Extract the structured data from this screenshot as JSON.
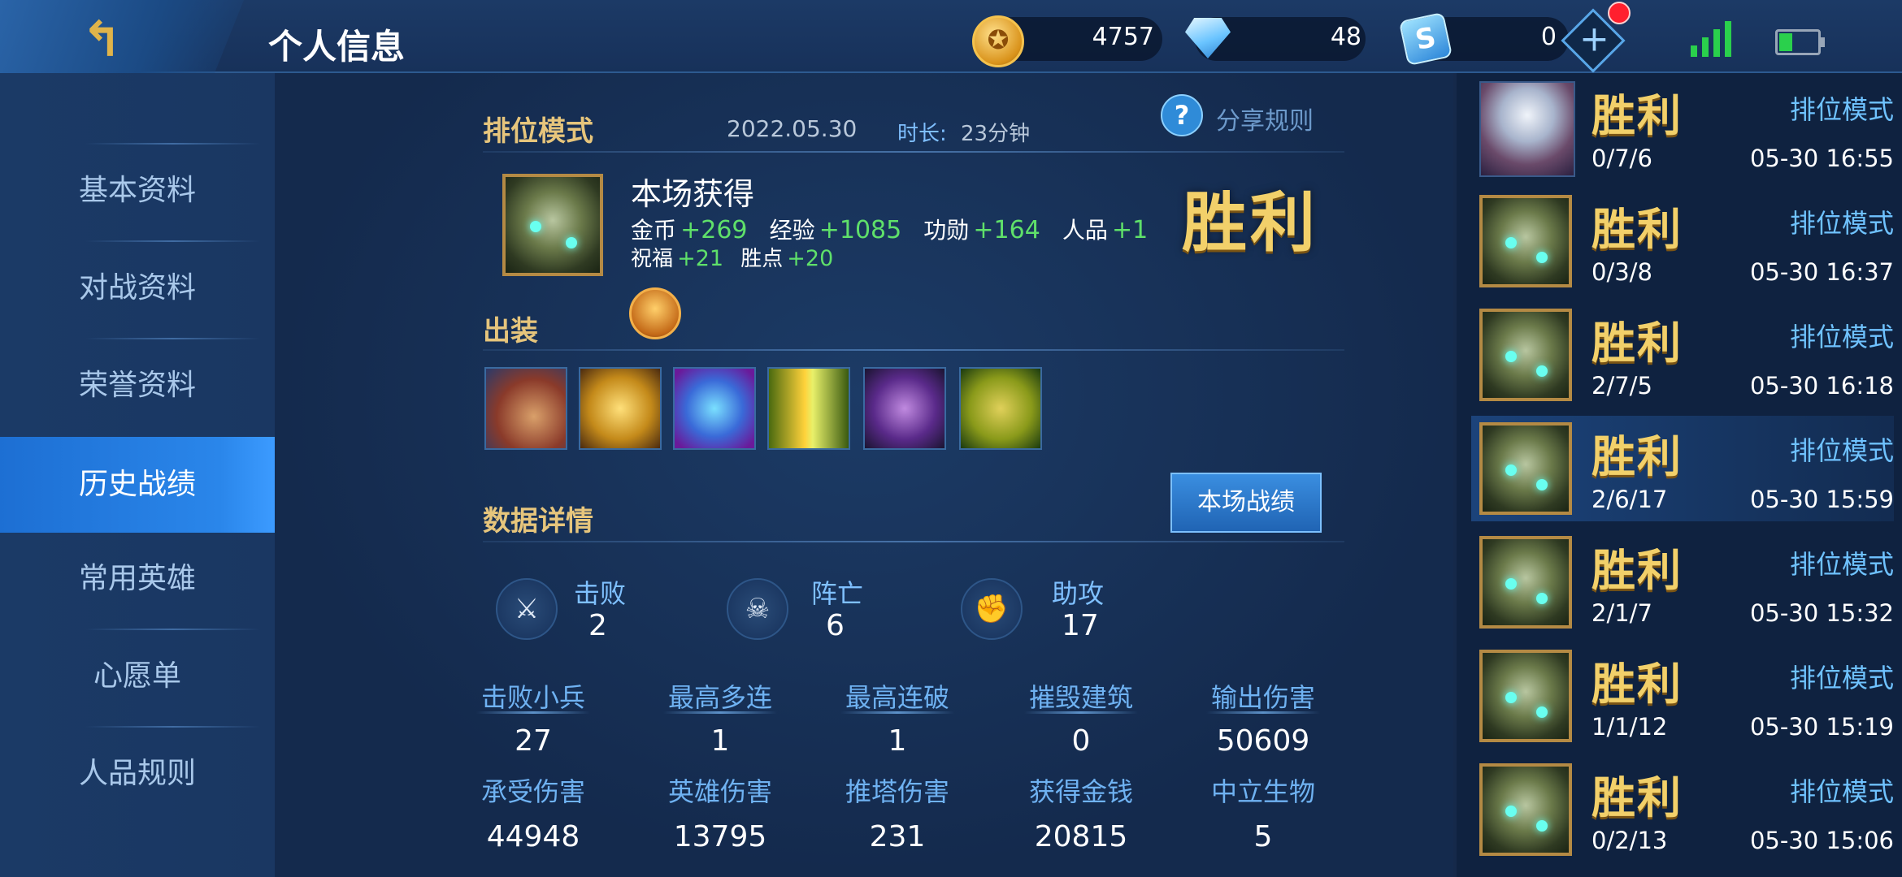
{
  "header": {
    "title": "个人信息",
    "gold": "4757",
    "diamonds": "48",
    "vouchers": "0",
    "plus_glyph": "+",
    "back_glyph": "↰"
  },
  "sidebar": {
    "items": [
      {
        "label": "基本资料"
      },
      {
        "label": "对战资料"
      },
      {
        "label": "荣誉资料"
      },
      {
        "label": "历史战绩",
        "active": true
      },
      {
        "label": "常用英雄"
      },
      {
        "label": "心愿单"
      },
      {
        "label": "人品规则"
      }
    ]
  },
  "match": {
    "mode": "排位模式",
    "date": "2022.05.30",
    "duration_label": "时长:",
    "duration": "23分钟",
    "share_label": "分享规则",
    "rewards_title": "本场获得",
    "rewards": {
      "gold_label": "金币",
      "gold": "+269",
      "exp_label": "经验",
      "exp": "+1085",
      "merit_label": "功勋",
      "merit": "+164",
      "rp_label": "人品",
      "rp": "+1",
      "bless_label": "祝福",
      "bless": "+21",
      "point_label": "胜点",
      "point": "+20"
    },
    "result": "胜利",
    "equipment_label": "出装",
    "details_label": "数据详情",
    "details_button": "本场战绩",
    "kda": {
      "kills_label": "击败",
      "kills": "2",
      "deaths_label": "阵亡",
      "deaths": "6",
      "assists_label": "助攻",
      "assists": "17"
    },
    "stats": [
      {
        "label": "击败小兵",
        "value": "27"
      },
      {
        "label": "最高多连",
        "value": "1"
      },
      {
        "label": "最高连破",
        "value": "1"
      },
      {
        "label": "摧毁建筑",
        "value": "0"
      },
      {
        "label": "输出伤害",
        "value": "50609"
      },
      {
        "label": "承受伤害",
        "value": "44948"
      },
      {
        "label": "英雄伤害",
        "value": "13795"
      },
      {
        "label": "推塔伤害",
        "value": "231"
      },
      {
        "label": "获得金钱",
        "value": "20815"
      },
      {
        "label": "中立生物",
        "value": "5"
      }
    ],
    "icons": {
      "kills": "kills-icon",
      "deaths": "skull-icon",
      "assists": "assist-icon",
      "kills_glyph": "⚔",
      "deaths_glyph": "☠",
      "assists_glyph": "✊",
      "help_glyph": "?"
    }
  },
  "history": [
    {
      "result": "胜利",
      "mode": "排位模式",
      "kda": "0/7/6",
      "time": "05-30 16:55"
    },
    {
      "result": "胜利",
      "mode": "排位模式",
      "kda": "0/3/8",
      "time": "05-30 16:37"
    },
    {
      "result": "胜利",
      "mode": "排位模式",
      "kda": "2/7/5",
      "time": "05-30 16:18"
    },
    {
      "result": "胜利",
      "mode": "排位模式",
      "kda": "2/6/17",
      "time": "05-30 15:59",
      "active": true
    },
    {
      "result": "胜利",
      "mode": "排位模式",
      "kda": "2/1/7",
      "time": "05-30 15:32"
    },
    {
      "result": "胜利",
      "mode": "排位模式",
      "kda": "1/1/12",
      "time": "05-30 15:19"
    },
    {
      "result": "胜利",
      "mode": "排位模式",
      "kda": "0/2/13",
      "time": "05-30 15:06"
    }
  ],
  "colors": {
    "accent_gold": "#e6c57c",
    "gain_green": "#5fe06a",
    "link_blue": "#6fc2ff",
    "active_blue": "#2a86ea"
  }
}
